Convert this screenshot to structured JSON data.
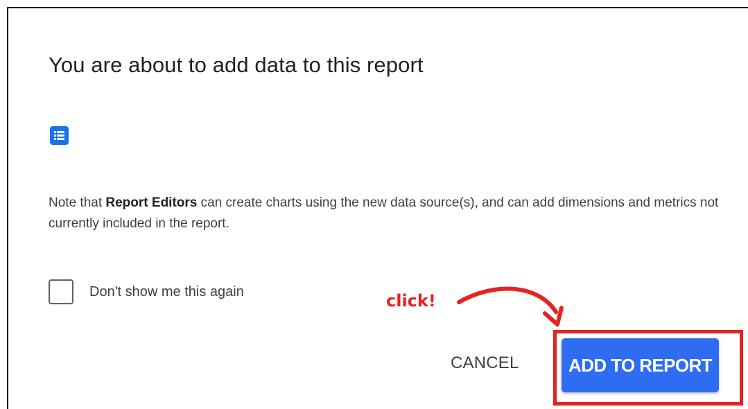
{
  "dialog": {
    "title": "You are about to add data to this report",
    "data_source_icon": "list-icon",
    "note": {
      "prefix": "Note that ",
      "bold": "Report Editors",
      "suffix": " can create charts using the new data source(s), and can add dimensions and metrics not currently included in the report."
    },
    "checkbox": {
      "label": "Don't show me this again",
      "checked": false
    },
    "buttons": {
      "cancel_label": "CANCEL",
      "add_label": "ADD TO REPORT"
    },
    "colors": {
      "primary": "#2e6df2",
      "icon": "#1a73e8",
      "annotation": "#e52421"
    }
  },
  "annotation": {
    "text": "click!",
    "arrow_icon": "curved-arrow-icon",
    "highlight": "add-to-report-button"
  }
}
